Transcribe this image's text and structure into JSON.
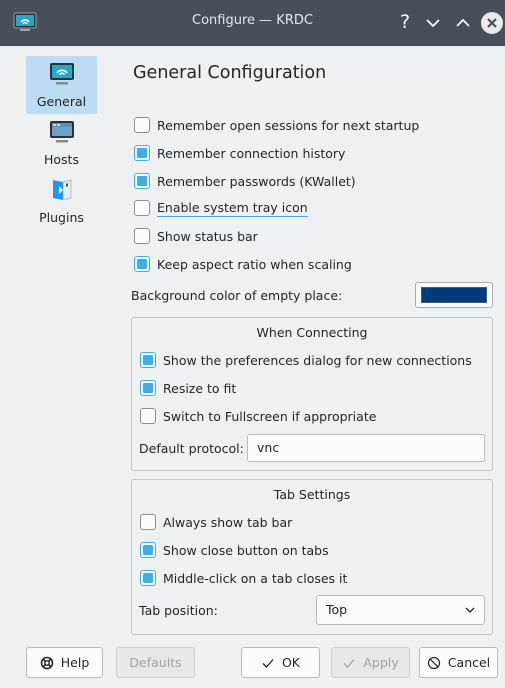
{
  "window": {
    "title": "Configure — KRDC"
  },
  "sidebar": {
    "items": [
      {
        "label": "General",
        "icon": "network-monitor-icon",
        "active": true
      },
      {
        "label": "Hosts",
        "icon": "hosts-monitor-icon",
        "active": false
      },
      {
        "label": "Plugins",
        "icon": "plugins-icon",
        "active": false
      }
    ]
  },
  "page": {
    "title": "General Configuration"
  },
  "general": {
    "options": [
      {
        "label": "Remember open sessions for next startup",
        "checked": false
      },
      {
        "label": "Remember connection history",
        "checked": true
      },
      {
        "label": "Remember passwords (KWallet)",
        "checked": true
      },
      {
        "label": "Enable system tray icon",
        "checked": false
      },
      {
        "label": "Show status bar",
        "checked": false
      },
      {
        "label": "Keep aspect ratio when scaling",
        "checked": true
      }
    ],
    "background_label": "Background color of empty place:",
    "background_color": "#003b7b"
  },
  "connecting": {
    "title": "When Connecting",
    "options": [
      {
        "label": "Show the preferences dialog for new connections",
        "checked": true
      },
      {
        "label": "Resize to fit",
        "checked": true
      },
      {
        "label": "Switch to Fullscreen if appropriate",
        "checked": false
      }
    ],
    "protocol_label": "Default protocol:",
    "protocol_value": "vnc"
  },
  "tabs": {
    "title": "Tab Settings",
    "options": [
      {
        "label": "Always show tab bar",
        "checked": false
      },
      {
        "label": "Show close button on tabs",
        "checked": true
      },
      {
        "label": "Middle-click on a tab closes it",
        "checked": true
      }
    ],
    "position_label": "Tab position:",
    "position_value": "Top"
  },
  "buttons": {
    "help": "Help",
    "defaults": "Defaults",
    "ok": "OK",
    "apply": "Apply",
    "cancel": "Cancel"
  },
  "colors": {
    "accent": "#3daee9",
    "titlebar": "#475057",
    "selection": "#bcdcf3"
  }
}
